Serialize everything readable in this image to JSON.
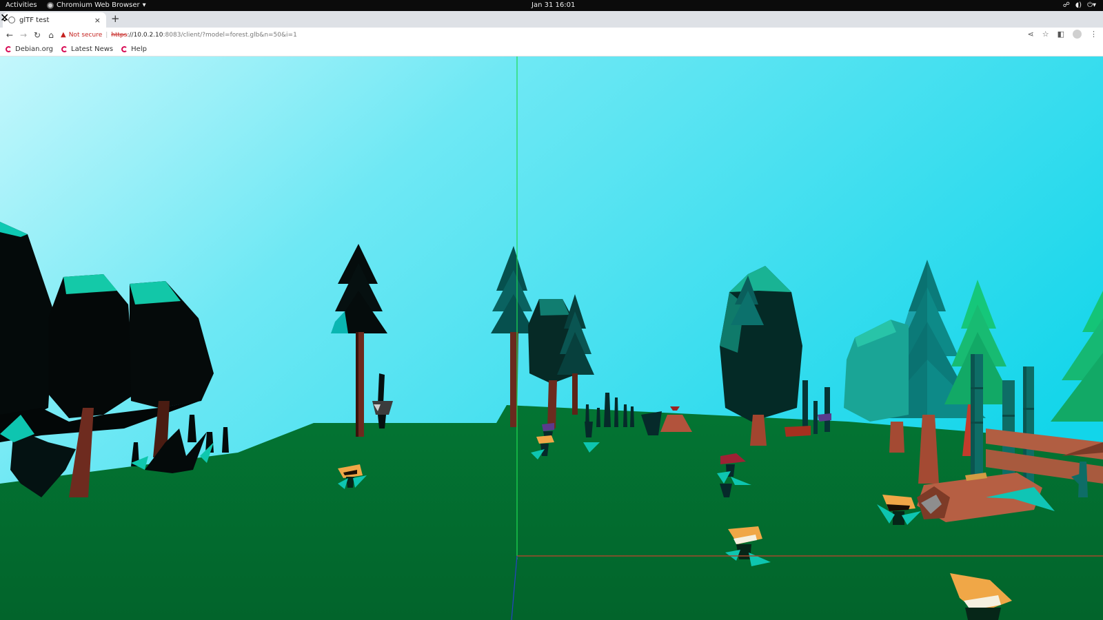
{
  "system": {
    "activities_label": "Activities",
    "app_name": "Chromium Web Browser",
    "clock": "Jan 31  16:01",
    "tray_icons": [
      "network-icon",
      "volume-icon",
      "power-icon"
    ]
  },
  "browser": {
    "tab": {
      "title": "glTF test",
      "close": "×"
    },
    "new_tab": "+",
    "address": {
      "security_label": "Not secure",
      "url_scheme": "https",
      "url_host": "://10.0.2.10",
      "url_rest": ":8083/client/?model=forest.glb&n=50&i=1"
    },
    "bookmarks": [
      {
        "label": "Debian.org"
      },
      {
        "label": "Latest News"
      },
      {
        "label": "Help"
      }
    ]
  },
  "scene": {
    "model": "forest.glb",
    "colors": {
      "sky_top": "#b6f6fb",
      "sky_bottom": "#1ad6ea",
      "ground": "#036b2f",
      "axis_green": "#1fdc52",
      "axis_red": "#a5492c",
      "axis_blue": "#2840c8"
    }
  }
}
